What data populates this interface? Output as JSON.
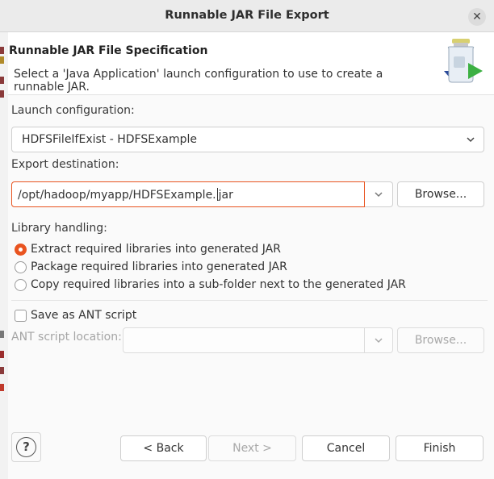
{
  "dialog": {
    "title": "Runnable JAR File Export",
    "close_icon": "close-icon"
  },
  "header": {
    "title": "Runnable JAR File Specification",
    "description": "Select a 'Java Application' launch configuration to use to create a runnable JAR.",
    "banner_icon": "jar-export-icon"
  },
  "launch": {
    "label": "Launch configuration:",
    "value": "HDFSFileIfExist - HDFSExample"
  },
  "export": {
    "label": "Export destination:",
    "value_before_caret": "/opt/hadoop/myapp/HDFSExample.",
    "value_after_caret": "jar",
    "browse_label": "Browse..."
  },
  "library": {
    "label": "Library handling:",
    "options": [
      {
        "label": "Extract required libraries into generated JAR",
        "checked": true
      },
      {
        "label": "Package required libraries into generated JAR",
        "checked": false
      },
      {
        "label": "Copy required libraries into a sub-folder next to the generated JAR",
        "checked": false
      }
    ]
  },
  "ant": {
    "checkbox_label": "Save as ANT script",
    "checked": false,
    "location_label": "ANT script location:",
    "location_value": "",
    "browse_label": "Browse..."
  },
  "footer": {
    "help_label": "?",
    "back_label": "< Back",
    "next_label": "Next >",
    "cancel_label": "Cancel",
    "finish_label": "Finish"
  },
  "colors": {
    "accent": "#e95420",
    "titlebar": "#ebebeb",
    "background": "#fafafa"
  }
}
